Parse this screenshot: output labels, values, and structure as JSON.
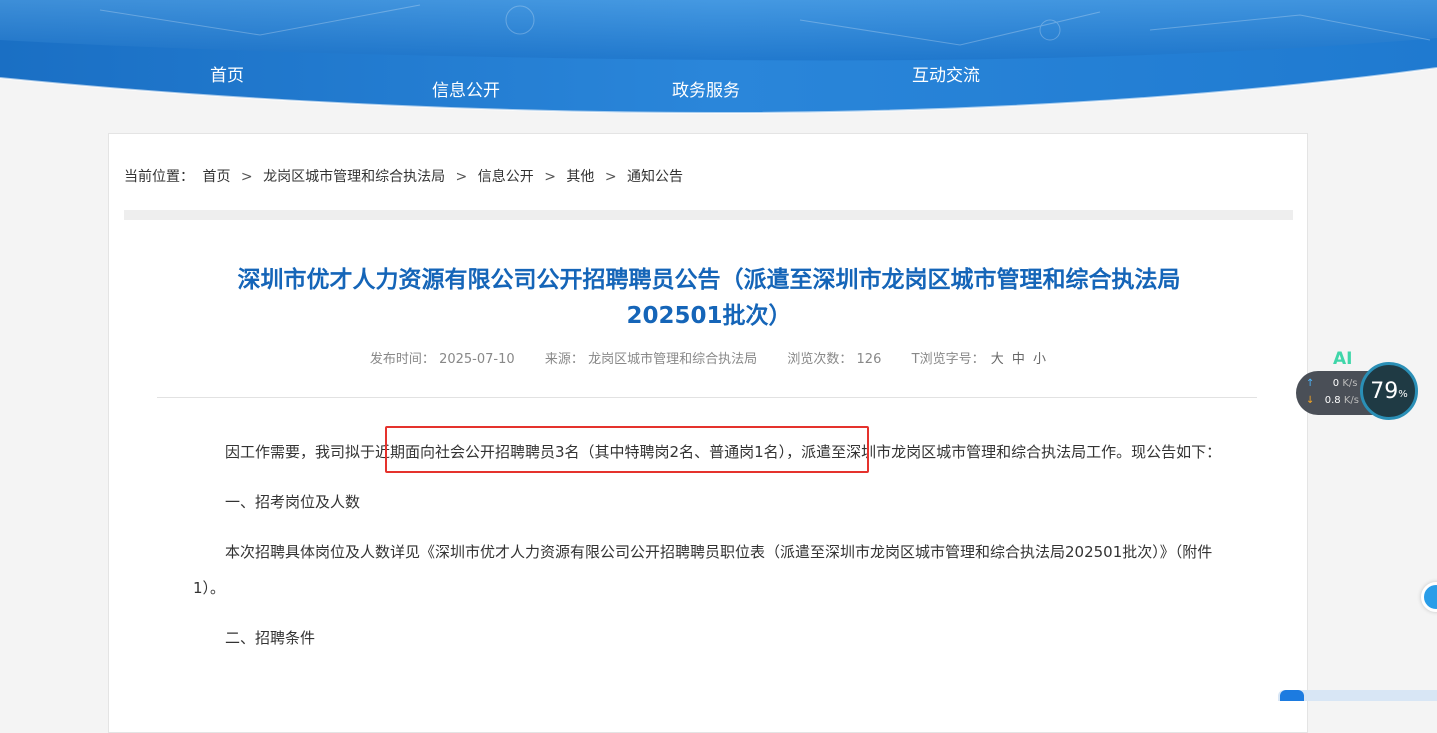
{
  "nav": {
    "items": [
      {
        "label": "首页"
      },
      {
        "label": "信息公开"
      },
      {
        "label": "政务服务"
      },
      {
        "label": "互动交流"
      }
    ]
  },
  "breadcrumb": {
    "prefix": "当前位置：",
    "items": [
      "首页",
      "龙岗区城市管理和综合执法局",
      "信息公开",
      "其他",
      "通知公告"
    ],
    "separator": ">"
  },
  "article": {
    "title_line1": "深圳市优才人力资源有限公司公开招聘聘员公告（派遣至深圳市龙岗区城市管理和综合执法局",
    "title_line2": "202501批次）",
    "meta": {
      "publish_label": "发布时间：",
      "publish_date": "2025-07-10",
      "source_label": "来源：",
      "source": "龙岗区城市管理和综合执法局",
      "views_label": "浏览次数：",
      "views": "126",
      "font_label": "T浏览字号：",
      "font_large": "大",
      "font_medium": "中",
      "font_small": "小"
    },
    "paragraphs": [
      "因工作需要，我司拟于近期面向社会公开招聘聘员3名（其中特聘岗2名、普通岗1名），派遣至深圳市龙岗区城市管理和综合执法局工作。现公告如下：",
      "一、招考岗位及人数",
      "本次招聘具体岗位及人数详见《深圳市优才人力资源有限公司公开招聘聘员职位表（派遣至深圳市龙岗区城市管理和综合执法局202501批次）》（附件1）。",
      "二、招聘条件"
    ]
  },
  "widget": {
    "ai_label": "AI",
    "upload": "0",
    "download": "0.8",
    "unit": "K/s",
    "percent": "79",
    "percent_sign": "%"
  },
  "colors": {
    "title": "#1565b8",
    "banner": "#1a73cc",
    "highlight": "#e5322d"
  }
}
